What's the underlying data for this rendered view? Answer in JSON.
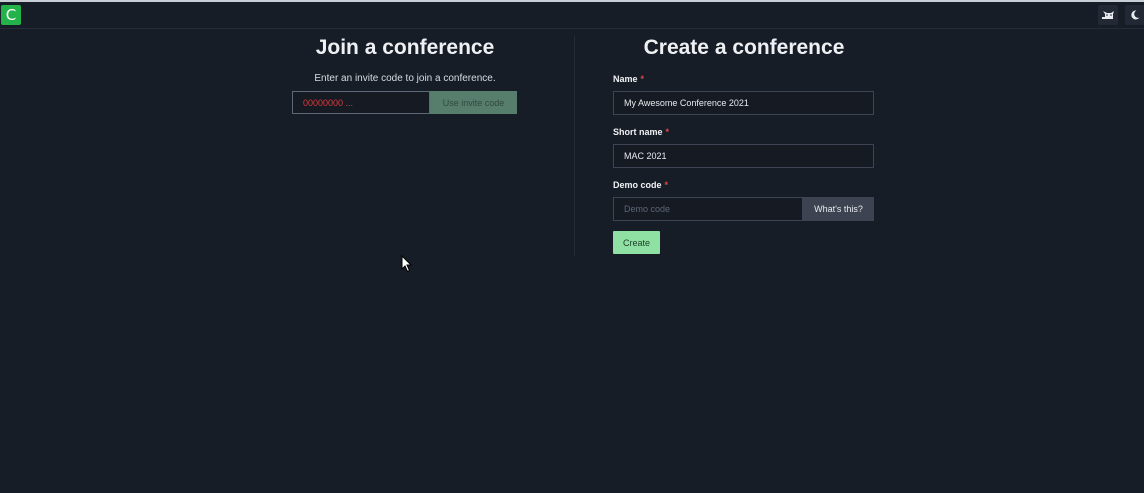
{
  "topbar": {
    "logo_letter": "C"
  },
  "icons": {
    "logo": "logo-icon",
    "cat": "cat-icon",
    "theme": "moon-icon",
    "cursor": "mouse-cursor-icon"
  },
  "colors": {
    "background": "#171d27",
    "logo": "#24b34a",
    "create_button": "#8fe1a3",
    "invite_button": "#577d6c",
    "required_marker": "#e04848",
    "invite_placeholder": "#e03a3a"
  },
  "join": {
    "title": "Join a conference",
    "description": "Enter an invite code to join a conference.",
    "invite_input_placeholder": "00000000 ...",
    "invite_button_label": "Use invite code"
  },
  "create": {
    "title": "Create a conference",
    "name_label": "Name",
    "name_value": "My Awesome Conference 2021",
    "short_name_label": "Short name",
    "short_name_value": "MAC 2021",
    "demo_code_label": "Demo code",
    "demo_code_placeholder": "Demo code",
    "whats_this_label": "What's this?",
    "create_button_label": "Create",
    "required_marker": "*"
  }
}
